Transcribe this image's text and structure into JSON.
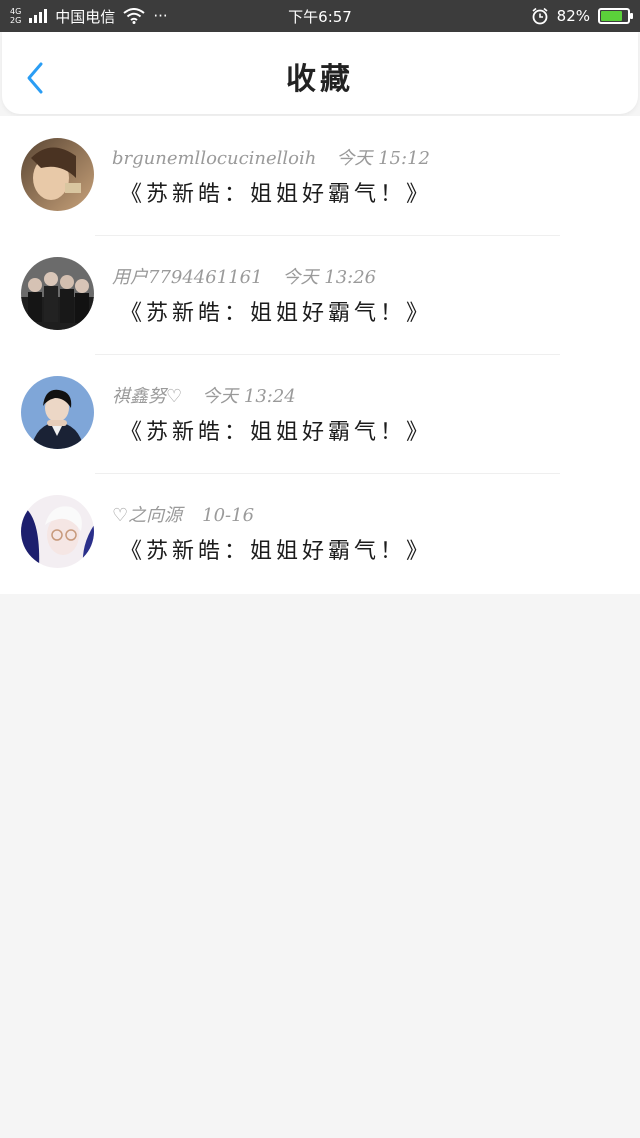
{
  "status_bar": {
    "net_top": "4G",
    "net_bottom": "2G",
    "carrier": "中国电信",
    "more": "···",
    "time": "下午6:57",
    "battery_percent": "82%",
    "battery_level": 0.82,
    "battery_color": "#5bd13a"
  },
  "header": {
    "title": "收藏",
    "accent_color": "#2a9df4"
  },
  "favorites": [
    {
      "username": "brgunemllocucinelloih",
      "time": "今天 15:12",
      "content": "《苏新皓：姐姐好霸气！》"
    },
    {
      "username": "用户7794461161",
      "time": "今天 13:26",
      "content": "《苏新皓：姐姐好霸气！》"
    },
    {
      "username": "祺鑫努♡",
      "time": "今天 13:24",
      "content": "《苏新皓：姐姐好霸气！》"
    },
    {
      "username": "♡之向源",
      "time": "10-16",
      "content": "《苏新皓：姐姐好霸气！》"
    }
  ]
}
